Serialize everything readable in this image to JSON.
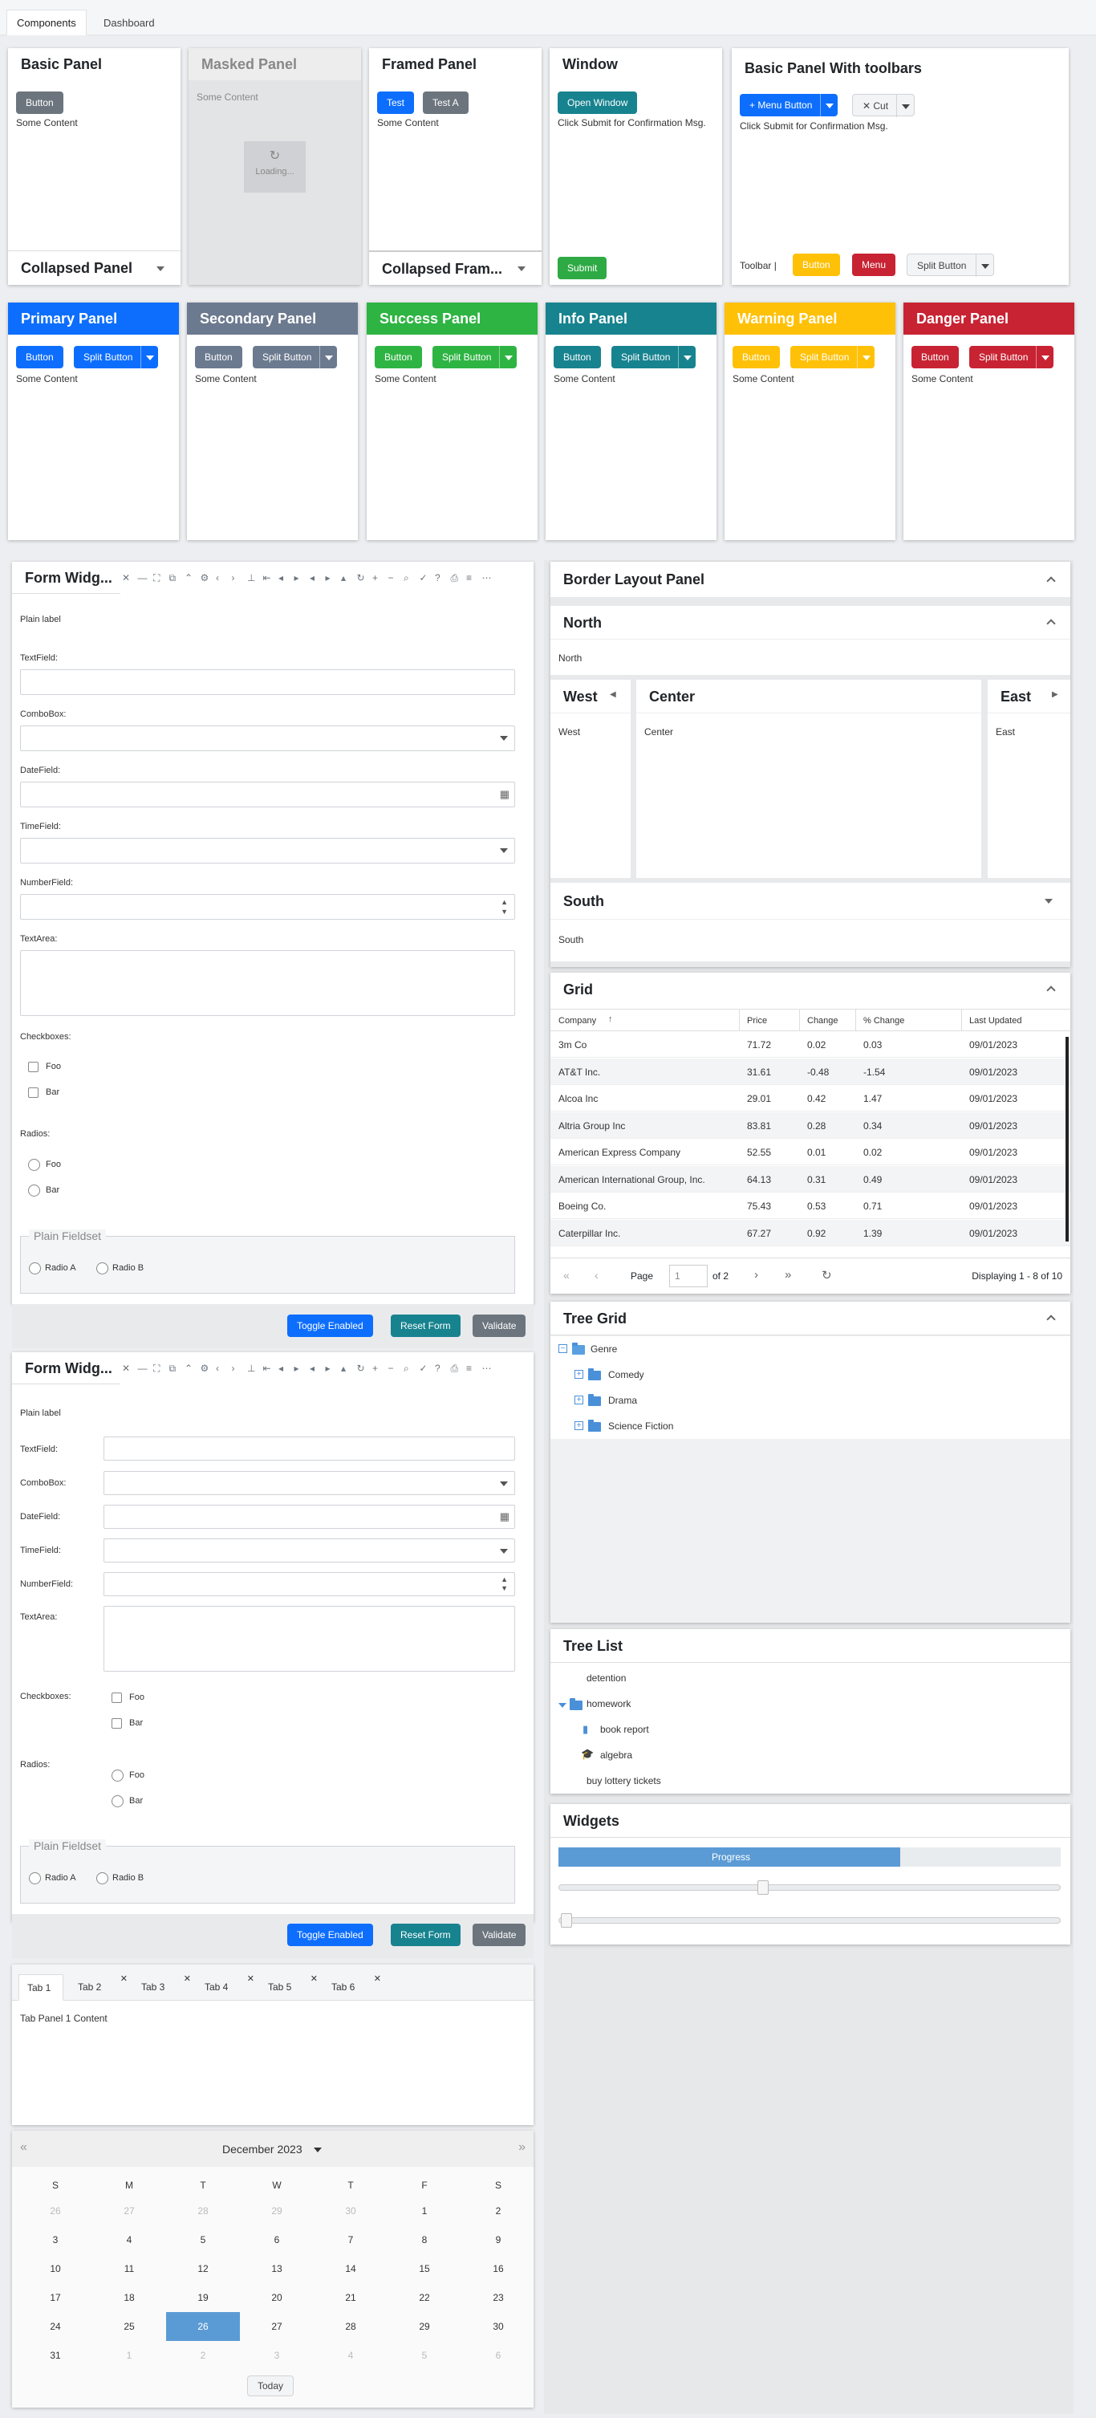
{
  "top_tabs": [
    "Components",
    "Dashboard"
  ],
  "basic_panel": {
    "title": "Basic Panel",
    "button": "Button",
    "content": "Some Content",
    "collapsed": "Collapsed Panel"
  },
  "masked_panel": {
    "title": "Masked Panel",
    "content": "Some Content",
    "loading": "Loading..."
  },
  "framed_panel": {
    "title": "Framed Panel",
    "btn1": "Test",
    "btn2": "Test A",
    "content": "Some Content",
    "collapsed": "Collapsed Fram..."
  },
  "window": {
    "title": "Window",
    "open": "Open Window",
    "msg": "Click Submit for Confirmation Msg.",
    "submit": "Submit"
  },
  "toolbar_panel": {
    "title": "Basic Panel With toolbars",
    "menu_button": "Menu Button",
    "cut": "Cut",
    "msg": "Click Submit for Confirmation Msg.",
    "toolbar_label": "Toolbar |",
    "button": "Button",
    "menu": "Menu",
    "split": "Split Button"
  },
  "colored_panels": [
    {
      "title": "Primary Panel",
      "color": "#0d6efd",
      "button": "Button",
      "split": "Split Button",
      "content": "Some Content"
    },
    {
      "title": "Secondary Panel",
      "color": "#6c7a8f",
      "button": "Button",
      "split": "Split Button",
      "content": "Some Content"
    },
    {
      "title": "Success Panel",
      "color": "#2eb443",
      "button": "Button",
      "split": "Split Button",
      "content": "Some Content"
    },
    {
      "title": "Info Panel",
      "color": "#17838f",
      "button": "Button",
      "split": "Split Button",
      "content": "Some Content"
    },
    {
      "title": "Warning Panel",
      "color": "#ffc107",
      "button": "Button",
      "split": "Split Button",
      "content": "Some Content"
    },
    {
      "title": "Danger Panel",
      "color": "#c82333",
      "button": "Button",
      "split": "Split Button",
      "content": "Some Content"
    }
  ],
  "form1": {
    "title": "Form Widg...",
    "plain_label": "Plain label",
    "textfield": "TextField:",
    "combobox": "ComboBox:",
    "datefield": "DateField:",
    "timefield": "TimeField:",
    "numberfield": "NumberField:",
    "textarea": "TextArea:",
    "checkboxes": "Checkboxes:",
    "foo": "Foo",
    "bar": "Bar",
    "radios": "Radios:",
    "fieldset": "Plain Fieldset",
    "radio_a": "Radio A",
    "radio_b": "Radio B",
    "toggle": "Toggle Enabled",
    "reset": "Reset Form",
    "validate": "Validate"
  },
  "form2": {
    "title": "Form Widg...",
    "plain_label": "Plain label",
    "textfield": "TextField:",
    "combobox": "ComboBox:",
    "datefield": "DateField:",
    "timefield": "TimeField:",
    "numberfield": "NumberField:",
    "textarea": "TextArea:",
    "checkboxes": "Checkboxes:",
    "foo": "Foo",
    "bar": "Bar",
    "radios": "Radios:",
    "fieldset": "Plain Fieldset",
    "radio_a": "Radio A",
    "radio_b": "Radio B",
    "toggle": "Toggle Enabled",
    "reset": "Reset Form",
    "validate": "Validate"
  },
  "tabs": {
    "items": [
      "Tab 1",
      "Tab 2",
      "Tab 3",
      "Tab 4",
      "Tab 5",
      "Tab 6"
    ],
    "content": "Tab Panel 1 Content"
  },
  "calendar": {
    "month": "December 2023",
    "days": [
      "S",
      "M",
      "T",
      "W",
      "T",
      "F",
      "S"
    ],
    "weeks": [
      [
        "26",
        "27",
        "28",
        "29",
        "30",
        "1",
        "2"
      ],
      [
        "3",
        "4",
        "5",
        "6",
        "7",
        "8",
        "9"
      ],
      [
        "10",
        "11",
        "12",
        "13",
        "14",
        "15",
        "16"
      ],
      [
        "17",
        "18",
        "19",
        "20",
        "21",
        "22",
        "23"
      ],
      [
        "24",
        "25",
        "26",
        "27",
        "28",
        "29",
        "30"
      ],
      [
        "31",
        "1",
        "2",
        "3",
        "4",
        "5",
        "6"
      ]
    ],
    "today": "Today",
    "selected": "26"
  },
  "border_layout": {
    "title": "Border Layout Panel",
    "north": "North",
    "west": "West",
    "center": "Center",
    "east": "East",
    "south": "South"
  },
  "grid": {
    "title": "Grid",
    "headers": [
      "Company",
      "Price",
      "Change",
      "% Change",
      "Last Updated"
    ],
    "rows": [
      [
        "3m Co",
        "71.72",
        "0.02",
        "0.03",
        "09/01/2023"
      ],
      [
        "AT&T Inc.",
        "31.61",
        "-0.48",
        "-1.54",
        "09/01/2023"
      ],
      [
        "Alcoa Inc",
        "29.01",
        "0.42",
        "1.47",
        "09/01/2023"
      ],
      [
        "Altria Group Inc",
        "83.81",
        "0.28",
        "0.34",
        "09/01/2023"
      ],
      [
        "American Express Company",
        "52.55",
        "0.01",
        "0.02",
        "09/01/2023"
      ],
      [
        "American International Group, Inc.",
        "64.13",
        "0.31",
        "0.49",
        "09/01/2023"
      ],
      [
        "Boeing Co.",
        "75.43",
        "0.53",
        "0.71",
        "09/01/2023"
      ],
      [
        "Caterpillar Inc.",
        "67.27",
        "0.92",
        "1.39",
        "09/01/2023"
      ]
    ],
    "page_label": "Page",
    "page": "1",
    "of": "of 2",
    "display": "Displaying 1 - 8 of 10"
  },
  "tree_grid": {
    "title": "Tree Grid",
    "root": "Genre",
    "children": [
      "Comedy",
      "Drama",
      "Science Fiction"
    ]
  },
  "tree_list": {
    "title": "Tree List",
    "items": [
      "detention",
      "homework",
      "book report",
      "algebra",
      "buy lottery tickets"
    ]
  },
  "widgets": {
    "title": "Widgets",
    "progress_label": "Progress",
    "progress": 0.68,
    "slider1": 0.4,
    "slider2": 0.0
  }
}
